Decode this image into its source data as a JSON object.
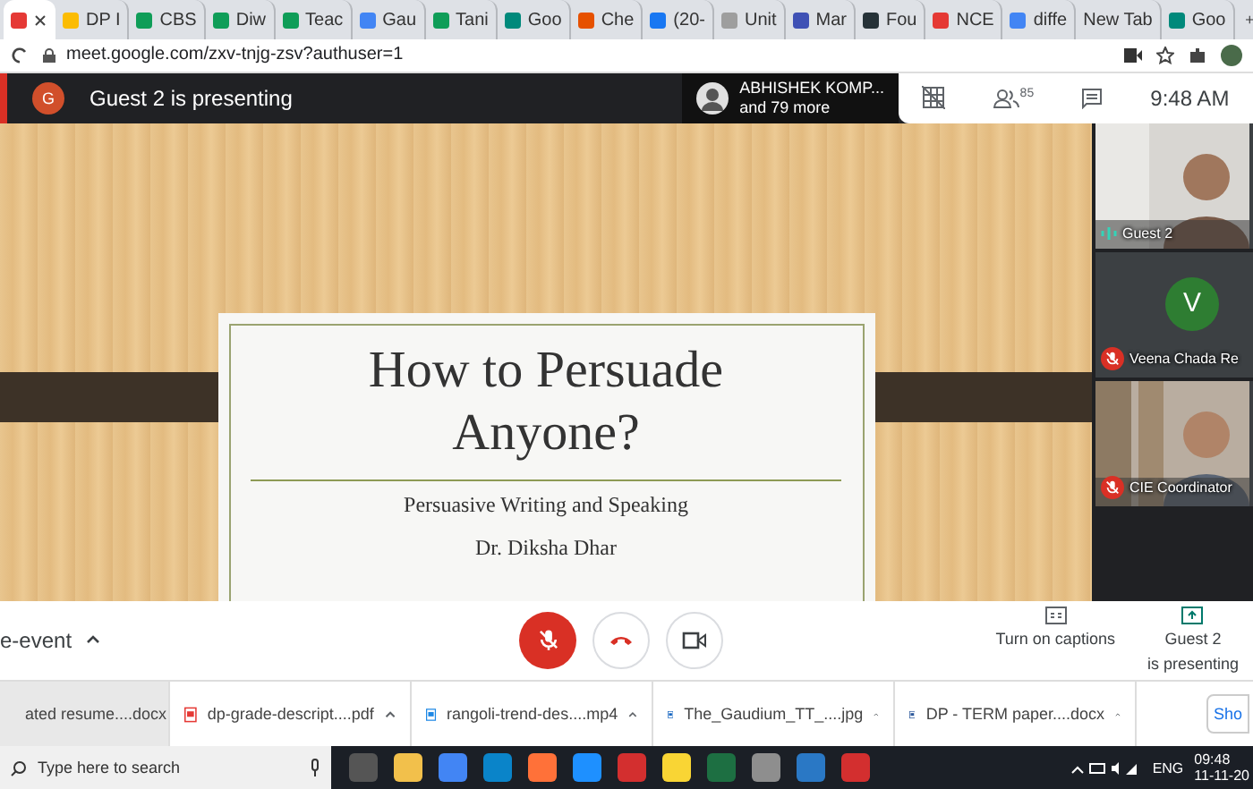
{
  "browser_tabs": [
    {
      "selected": true,
      "color": "#e53935"
    },
    {
      "label": "DP I",
      "selected": false,
      "color": "#fbbc04"
    },
    {
      "label": "CBS",
      "selected": false,
      "color": "#0f9d58"
    },
    {
      "label": "Diw",
      "selected": false,
      "color": "#0f9d58"
    },
    {
      "label": "Teac",
      "selected": false,
      "color": "#0f9d58"
    },
    {
      "label": "Gau",
      "selected": false,
      "color": "#4285f4"
    },
    {
      "label": "Tani",
      "selected": false,
      "color": "#0f9d58"
    },
    {
      "label": "Goo",
      "selected": false,
      "color": "#00897b"
    },
    {
      "label": "Che",
      "selected": false,
      "color": "#e65100"
    },
    {
      "label": "(20-",
      "selected": false,
      "color": "#1877f2"
    },
    {
      "label": "Unit",
      "selected": false,
      "color": "#9e9e9e"
    },
    {
      "label": "Mar",
      "selected": false,
      "color": "#3f51b5"
    },
    {
      "label": "Fou",
      "selected": false,
      "color": "#263238"
    },
    {
      "label": "NCE",
      "selected": false,
      "color": "#e53935"
    },
    {
      "label": "diffe",
      "selected": false,
      "color": "#4285f4"
    },
    {
      "label": "New Tab",
      "selected": false
    },
    {
      "label": "Goo",
      "selected": false,
      "color": "#00897b"
    }
  ],
  "address": "meet.google.com/zxv-tnjg-zsv?authuser=1",
  "meet_header": {
    "avatar_letter": "G",
    "presenting": "Guest 2 is presenting",
    "participant_name": "ABHISHEK KOMP...",
    "participant_more": "and 79 more",
    "people_count": "85",
    "time": "9:48 AM"
  },
  "slide": {
    "title": "How to Persuade Anyone?",
    "subtitle": "Persuasive Writing and Speaking",
    "author": "Dr. Diksha Dhar"
  },
  "tiles": [
    {
      "kind": "video",
      "name": "Guest 2",
      "muted": false
    },
    {
      "kind": "avatar",
      "name": "Veena Chada Re",
      "avatar_letter": "V",
      "muted": true
    },
    {
      "kind": "video",
      "name": "CIE Coordinator",
      "muted": true
    }
  ],
  "controls": {
    "meeting_name": "e-event",
    "mic_muted": true,
    "captions": "Turn on captions",
    "presenting": [
      "Guest 2",
      "is presenting"
    ]
  },
  "downloads": [
    {
      "name": "ated resume....docx",
      "selected": true,
      "kind": "word"
    },
    {
      "name": "dp-grade-descript....pdf",
      "selected": false,
      "kind": "pdf"
    },
    {
      "name": "rangoli-trend-des....mp4",
      "selected": false,
      "kind": "video"
    },
    {
      "name": "The_Gaudium_TT_....jpg",
      "selected": false
    },
    {
      "name": "DP - TERM paper....docx",
      "selected": false,
      "kind": "word"
    }
  ],
  "show_all": "Sho",
  "taskbar": {
    "search_placeholder": "Type here to search",
    "language": "ENG",
    "time": "09:48",
    "date": "11-11-20"
  }
}
